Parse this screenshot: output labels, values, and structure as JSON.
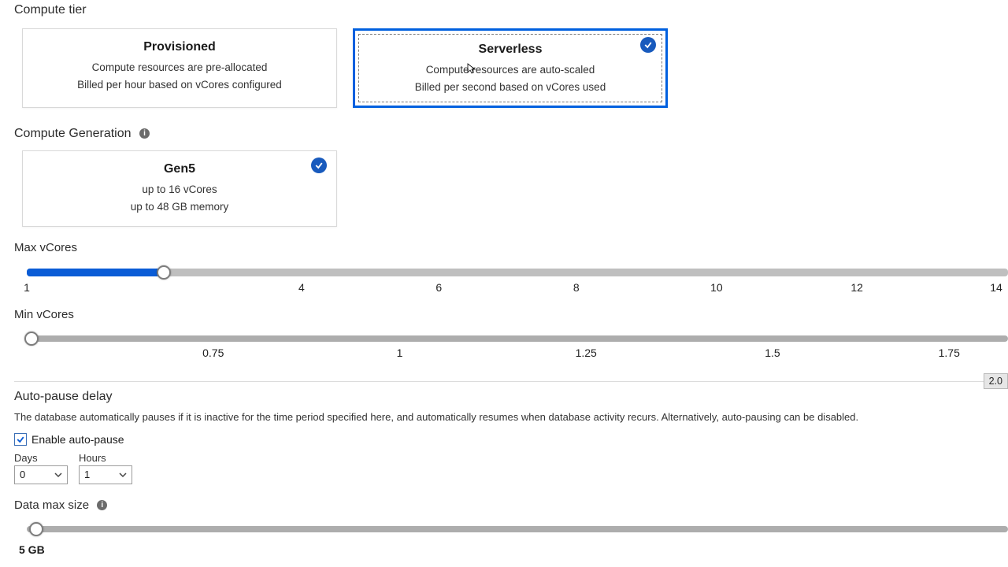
{
  "compute_tier": {
    "label": "Compute tier",
    "options": [
      {
        "title": "Provisioned",
        "line1": "Compute resources are pre-allocated",
        "line2": "Billed per hour based on vCores configured",
        "selected": false
      },
      {
        "title": "Serverless",
        "line1": "Compute resources are auto-scaled",
        "line2": "Billed per second based on vCores used",
        "selected": true
      }
    ]
  },
  "compute_generation": {
    "label": "Compute Generation",
    "option": {
      "title": "Gen5",
      "line1": "up to 16 vCores",
      "line2": "up to 48 GB memory",
      "selected": true
    }
  },
  "max_vcores": {
    "label": "Max vCores",
    "ticks": [
      "1",
      "4",
      "6",
      "8",
      "10",
      "12",
      "14"
    ],
    "tick_positions_pct": [
      0,
      28,
      42,
      56,
      70.3,
      84.6,
      98.8
    ],
    "value_pct": 14,
    "value": 2
  },
  "min_vcores": {
    "label": "Min vCores",
    "ticks": [
      "0.75",
      "1",
      "1.25",
      "1.5",
      "1.75"
    ],
    "tick_positions_pct": [
      19,
      38,
      57,
      76,
      94
    ],
    "value_pct": 0.5,
    "value": 0.5,
    "tooltip": "2.0"
  },
  "auto_pause": {
    "label": "Auto-pause delay",
    "help": "The database automatically pauses if it is inactive for the time period specified here, and automatically resumes when database activity recurs. Alternatively, auto-pausing can be disabled.",
    "checkbox_label": "Enable auto-pause",
    "checked": true,
    "days_label": "Days",
    "hours_label": "Hours",
    "days_value": "0",
    "hours_value": "1"
  },
  "data_max_size": {
    "label": "Data max size",
    "value_label": "5 GB",
    "value_pct": 1
  }
}
